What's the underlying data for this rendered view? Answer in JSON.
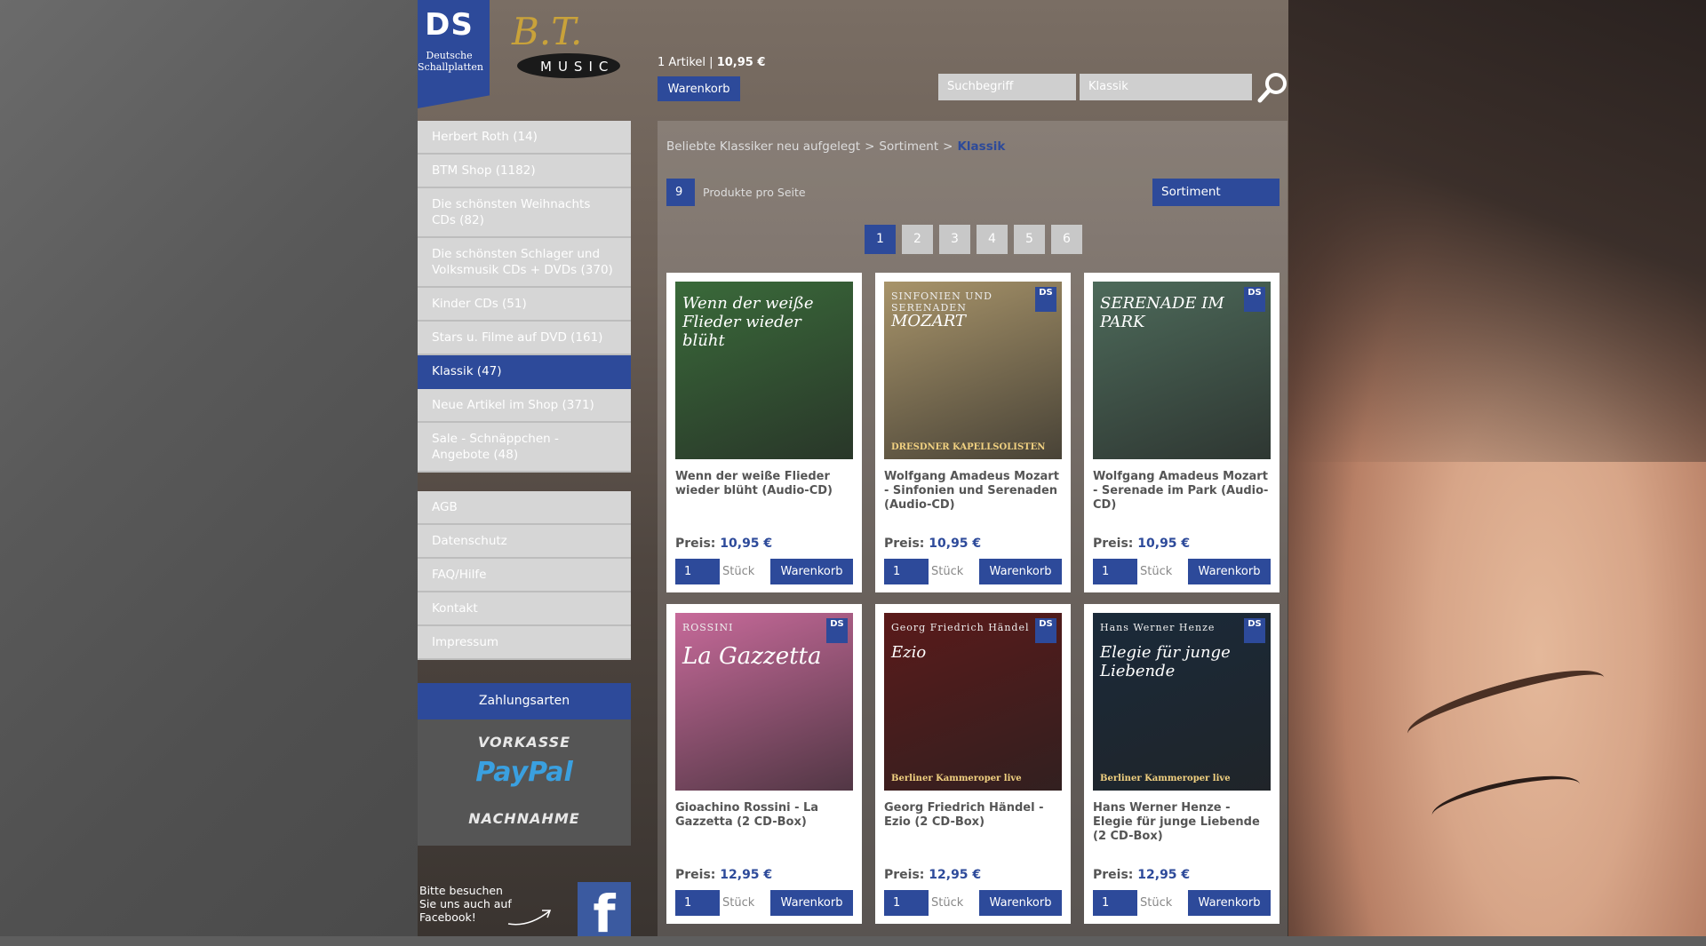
{
  "brand": {
    "ds_title": "DS",
    "ds_subtitle": "Deutsche Schallplatten",
    "btm_logo_alt": "B.T. MUSIC"
  },
  "cart": {
    "count_text": "1 Artikel",
    "total": "10,95 €",
    "button": "Warenkorb"
  },
  "search": {
    "term_placeholder": "Suchbegriff",
    "category": "Klassik"
  },
  "sidebar": {
    "items": [
      {
        "label": "Herbert Roth (14)",
        "active": false
      },
      {
        "label": "BTM Shop (1182)",
        "active": false
      },
      {
        "label": "Die schönsten Weihnachts CDs (82)",
        "active": false
      },
      {
        "label": "Die schönsten Schlager und Volksmusik CDs + DVDs (370)",
        "active": false
      },
      {
        "label": "Kinder CDs (51)",
        "active": false
      },
      {
        "label": "Stars u. Filme auf DVD (161)",
        "active": false
      },
      {
        "label": "Klassik (47)",
        "active": true
      },
      {
        "label": "Neue Artikel im Shop (371)",
        "active": false
      },
      {
        "label": "Sale - Schnäppchen - Angebote (48)",
        "active": false
      }
    ],
    "info_items": [
      "AGB",
      "Datenschutz",
      "FAQ/Hilfe",
      "Kontakt",
      "Impressum"
    ],
    "payment": {
      "title": "Zahlungsarten",
      "methods": [
        "VORKASSE",
        "PayPal",
        "NACHNAHME"
      ]
    },
    "facebook_text": "Bitte besuchen Sie uns auch auf Facebook!"
  },
  "breadcrumb": [
    "Beliebte Klassiker neu aufgelegt",
    "Sortiment",
    "Klassik"
  ],
  "breadcrumb_sep": ">",
  "listing": {
    "per_page": "9",
    "per_page_label": "Produkte pro Seite",
    "sort": "Sortiment",
    "pages": [
      "1",
      "2",
      "3",
      "4",
      "5",
      "6"
    ],
    "current_page": "1"
  },
  "products": [
    {
      "title": "Wenn der weiße Flieder wieder blüht (Audio-CD)",
      "price_label": "Preis:",
      "price": "10,95 €",
      "qty": "1",
      "unit": "Stück",
      "button": "Warenkorb",
      "cover_text": "Wenn der weiße Flieder wieder blüht",
      "cover_color": "#3a6a3a"
    },
    {
      "title": "Wolfgang Amadeus Mozart - Sinfonien und Serenaden (Audio-CD)",
      "price_label": "Preis:",
      "price": "10,95 €",
      "qty": "1",
      "unit": "Stück",
      "button": "Warenkorb",
      "cover_text": "MOZART",
      "cover_sub": "SINFONIEN UND SERENADEN",
      "cover_bottom": "DRESDNER KAPELLSOLISTEN",
      "cover_color": "#a8946a"
    },
    {
      "title": "Wolfgang Amadeus Mozart - Serenade im Park (Audio-CD)",
      "price_label": "Preis:",
      "price": "10,95 €",
      "qty": "1",
      "unit": "Stück",
      "button": "Warenkorb",
      "cover_text": "SERENADE IM PARK",
      "cover_color": "#4d6a5a"
    },
    {
      "title": "Gioachino Rossini - La Gazzetta (2 CD-Box)",
      "price_label": "Preis:",
      "price": "12,95 €",
      "qty": "1",
      "unit": "Stück",
      "button": "Warenkorb",
      "cover_text": "La Gazzetta",
      "cover_sub": "ROSSINI",
      "cover_color": "#c76a9a"
    },
    {
      "title": "Georg Friedrich Händel - Ezio (2 CD-Box)",
      "price_label": "Preis:",
      "price": "12,95 €",
      "qty": "1",
      "unit": "Stück",
      "button": "Warenkorb",
      "cover_text": "Ezio",
      "cover_sub": "Georg Friedrich Händel",
      "cover_bottom": "Berliner Kammeroper live",
      "cover_color": "#5a1a1a"
    },
    {
      "title": "Hans Werner Henze - Elegie für junge Liebende (2 CD-Box)",
      "price_label": "Preis:",
      "price": "12,95 €",
      "qty": "1",
      "unit": "Stück",
      "button": "Warenkorb",
      "cover_text": "Elegie für junge Liebende",
      "cover_sub": "Hans Werner Henze",
      "cover_bottom": "Berliner Kammeroper live",
      "cover_color": "#1a2a3a"
    }
  ]
}
